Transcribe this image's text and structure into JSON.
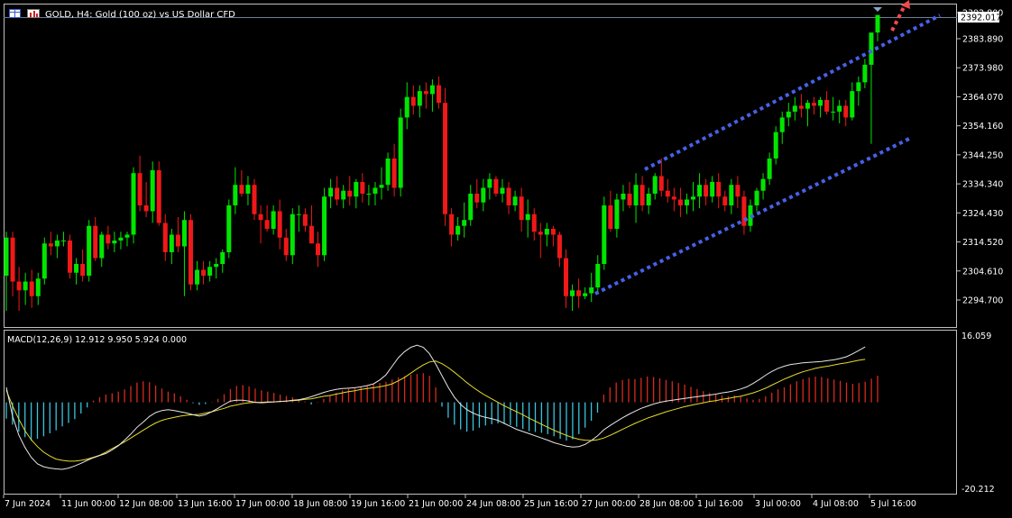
{
  "window": {
    "title": "GOLD, H4:  Gold (100 oz) vs US Dollar CFD",
    "icons": [
      "grid-icon",
      "bars-icon"
    ]
  },
  "colors": {
    "background": "#000000",
    "frame": "#c0c0c0",
    "axis_text": "#ffffff",
    "bull_candle": "#00e600",
    "bear_candle": "#f01818",
    "channel_line": "#4661e8",
    "forecast_arrow": "#f04a4a",
    "macd_positive": "#d62a1c",
    "macd_negative": "#39c3de",
    "macd_line": "#e6e6e6",
    "signal_line": "#e6dc2a",
    "price_tag_bg": "#ffffff",
    "price_tag_text": "#000000"
  },
  "price_axis": {
    "labels": [
      "2392.800",
      "2383.890",
      "2373.980",
      "2364.070",
      "2354.160",
      "2344.250",
      "2334.340",
      "2324.430",
      "2314.520",
      "2304.610",
      "2294.700"
    ],
    "current_price": "2392.017"
  },
  "macd": {
    "label": "MACD(12,26,9) 12.912 9.950 5.924 0.000",
    "axis_top": "16.059",
    "axis_bottom": "-20.212"
  },
  "time_axis": {
    "labels": [
      "7 Jun 2024",
      "11 Jun 00:00",
      "12 Jun 08:00",
      "13 Jun 16:00",
      "17 Jun 00:00",
      "18 Jun 08:00",
      "19 Jun 16:00",
      "21 Jun 00:00",
      "24 Jun 08:00",
      "25 Jun 16:00",
      "27 Jun 00:00",
      "28 Jun 08:00",
      "1 Jul 16:00",
      "3 Jul 00:00",
      "4 Jul 08:00",
      "5 Jul 16:00"
    ]
  },
  "chart_data": [
    {
      "type": "candlestick",
      "symbol": "GOLD",
      "timeframe": "H4",
      "x_labels": [
        "7 Jun 2024",
        "11 Jun 00:00",
        "12 Jun 08:00",
        "13 Jun 16:00",
        "17 Jun 00:00",
        "18 Jun 08:00",
        "19 Jun 16:00",
        "21 Jun 00:00",
        "24 Jun 08:00",
        "25 Jun 16:00",
        "27 Jun 00:00",
        "28 Jun 08:00",
        "1 Jul 16:00",
        "3 Jul 00:00",
        "4 Jul 08:00",
        "5 Jul 16:00"
      ],
      "ylim": [
        2289.2,
        2395.0
      ],
      "candles": [
        [
          2303,
          2318,
          2291,
          2316
        ],
        [
          2316,
          2318,
          2296,
          2301
        ],
        [
          2301,
          2306,
          2291,
          2298
        ],
        [
          2298,
          2304,
          2293,
          2301
        ],
        [
          2301,
          2305,
          2292,
          2296
        ],
        [
          2296,
          2304,
          2293,
          2302
        ],
        [
          2302,
          2316,
          2300,
          2314
        ],
        [
          2314,
          2318,
          2310,
          2313
        ],
        [
          2313,
          2317,
          2309,
          2315
        ],
        [
          2315,
          2318,
          2313,
          2315
        ],
        [
          2315,
          2317,
          2302,
          2304
        ],
        [
          2304,
          2309,
          2300,
          2307
        ],
        [
          2307,
          2312,
          2301,
          2303
        ],
        [
          2303,
          2322,
          2301,
          2320
        ],
        [
          2320,
          2323,
          2308,
          2309
        ],
        [
          2309,
          2318,
          2306,
          2317
        ],
        [
          2317,
          2320,
          2312,
          2314
        ],
        [
          2314,
          2318,
          2311,
          2315
        ],
        [
          2315,
          2318,
          2312,
          2316
        ],
        [
          2316,
          2318,
          2313,
          2317
        ],
        [
          2317,
          2340,
          2314,
          2338
        ],
        [
          2338,
          2344,
          2325,
          2327
        ],
        [
          2327,
          2335,
          2323,
          2325
        ],
        [
          2325,
          2342,
          2321,
          2339
        ],
        [
          2339,
          2342,
          2320,
          2321
        ],
        [
          2321,
          2324,
          2308,
          2311
        ],
        [
          2311,
          2319,
          2307,
          2317
        ],
        [
          2317,
          2323,
          2311,
          2313
        ],
        [
          2313,
          2325,
          2296,
          2322
        ],
        [
          2322,
          2324,
          2298,
          2300
        ],
        [
          2300,
          2308,
          2298,
          2305
        ],
        [
          2305,
          2308,
          2300,
          2303
        ],
        [
          2303,
          2308,
          2301,
          2306
        ],
        [
          2306,
          2309,
          2302,
          2307
        ],
        [
          2307,
          2312,
          2304,
          2311
        ],
        [
          2311,
          2329,
          2309,
          2327
        ],
        [
          2327,
          2340,
          2324,
          2334
        ],
        [
          2334,
          2339,
          2330,
          2331
        ],
        [
          2331,
          2337,
          2327,
          2334
        ],
        [
          2334,
          2336,
          2322,
          2324
        ],
        [
          2324,
          2327,
          2314,
          2322
        ],
        [
          2322,
          2327,
          2318,
          2319
        ],
        [
          2319,
          2327,
          2317,
          2325
        ],
        [
          2325,
          2329,
          2312,
          2316
        ],
        [
          2316,
          2319,
          2308,
          2310
        ],
        [
          2310,
          2326,
          2307,
          2324
        ],
        [
          2324,
          2327,
          2318,
          2324
        ],
        [
          2324,
          2326,
          2318,
          2320
        ],
        [
          2320,
          2327,
          2314,
          2314
        ],
        [
          2314,
          2318,
          2306,
          2310
        ],
        [
          2310,
          2333,
          2308,
          2330
        ],
        [
          2330,
          2336,
          2326,
          2333
        ],
        [
          2333,
          2337,
          2327,
          2329
        ],
        [
          2329,
          2334,
          2326,
          2332
        ],
        [
          2332,
          2337,
          2327,
          2330
        ],
        [
          2330,
          2336,
          2326,
          2335
        ],
        [
          2335,
          2338,
          2328,
          2331
        ],
        [
          2331,
          2334,
          2327,
          2331
        ],
        [
          2331,
          2335,
          2327,
          2333
        ],
        [
          2333,
          2340,
          2329,
          2334
        ],
        [
          2334,
          2345,
          2332,
          2343
        ],
        [
          2343,
          2348,
          2330,
          2333
        ],
        [
          2333,
          2360,
          2330,
          2357
        ],
        [
          2357,
          2369,
          2353,
          2364
        ],
        [
          2364,
          2368,
          2358,
          2361
        ],
        [
          2361,
          2368,
          2357,
          2366
        ],
        [
          2366,
          2369,
          2360,
          2365
        ],
        [
          2365,
          2370,
          2359,
          2368
        ],
        [
          2368,
          2371,
          2360,
          2362
        ],
        [
          2362,
          2367,
          2320,
          2324
        ],
        [
          2324,
          2326,
          2313,
          2317
        ],
        [
          2317,
          2323,
          2315,
          2320
        ],
        [
          2320,
          2328,
          2316,
          2322
        ],
        [
          2322,
          2334,
          2320,
          2331
        ],
        [
          2331,
          2336,
          2326,
          2328
        ],
        [
          2328,
          2336,
          2325,
          2333
        ],
        [
          2333,
          2338,
          2329,
          2336
        ],
        [
          2336,
          2337,
          2330,
          2331
        ],
        [
          2331,
          2336,
          2328,
          2333
        ],
        [
          2333,
          2335,
          2324,
          2327
        ],
        [
          2327,
          2332,
          2325,
          2330
        ],
        [
          2330,
          2333,
          2318,
          2322
        ],
        [
          2322,
          2329,
          2316,
          2324
        ],
        [
          2324,
          2326,
          2315,
          2318
        ],
        [
          2318,
          2321,
          2309,
          2317
        ],
        [
          2317,
          2321,
          2313,
          2319
        ],
        [
          2319,
          2320,
          2313,
          2317
        ],
        [
          2317,
          2318,
          2306,
          2309
        ],
        [
          2309,
          2312,
          2292,
          2296
        ],
        [
          2296,
          2300,
          2291,
          2298
        ],
        [
          2298,
          2302,
          2292,
          2296
        ],
        [
          2296,
          2299,
          2295,
          2297
        ],
        [
          2297,
          2304,
          2294,
          2299
        ],
        [
          2299,
          2310,
          2297,
          2307
        ],
        [
          2307,
          2330,
          2305,
          2327
        ],
        [
          2327,
          2332,
          2318,
          2319
        ],
        [
          2319,
          2331,
          2316,
          2329
        ],
        [
          2329,
          2334,
          2325,
          2331
        ],
        [
          2331,
          2335,
          2326,
          2327
        ],
        [
          2327,
          2338,
          2321,
          2334
        ],
        [
          2334,
          2337,
          2325,
          2327
        ],
        [
          2327,
          2333,
          2324,
          2331
        ],
        [
          2331,
          2338,
          2329,
          2337
        ],
        [
          2337,
          2343,
          2330,
          2332
        ],
        [
          2332,
          2336,
          2328,
          2330
        ],
        [
          2330,
          2333,
          2325,
          2329
        ],
        [
          2329,
          2333,
          2323,
          2327
        ],
        [
          2327,
          2331,
          2324,
          2329
        ],
        [
          2329,
          2335,
          2325,
          2330
        ],
        [
          2330,
          2338,
          2326,
          2334
        ],
        [
          2334,
          2336,
          2327,
          2330
        ],
        [
          2330,
          2337,
          2328,
          2335
        ],
        [
          2335,
          2338,
          2326,
          2330
        ],
        [
          2330,
          2332,
          2325,
          2327
        ],
        [
          2327,
          2336,
          2324,
          2334
        ],
        [
          2334,
          2337,
          2326,
          2330
        ],
        [
          2330,
          2332,
          2317,
          2320
        ],
        [
          2320,
          2329,
          2318,
          2327
        ],
        [
          2327,
          2333,
          2325,
          2332
        ],
        [
          2332,
          2338,
          2329,
          2336
        ],
        [
          2336,
          2345,
          2334,
          2343
        ],
        [
          2343,
          2354,
          2341,
          2352
        ],
        [
          2352,
          2359,
          2348,
          2357
        ],
        [
          2357,
          2362,
          2354,
          2359
        ],
        [
          2359,
          2364,
          2356,
          2361
        ],
        [
          2361,
          2365,
          2357,
          2360
        ],
        [
          2360,
          2363,
          2354,
          2362
        ],
        [
          2362,
          2364,
          2358,
          2361
        ],
        [
          2361,
          2364,
          2357,
          2363
        ],
        [
          2363,
          2366,
          2358,
          2359
        ],
        [
          2359,
          2364,
          2356,
          2359
        ],
        [
          2359,
          2363,
          2355,
          2361
        ],
        [
          2361,
          2363,
          2354,
          2357
        ],
        [
          2357,
          2369,
          2356,
          2366
        ],
        [
          2366,
          2371,
          2361,
          2369
        ],
        [
          2369,
          2377,
          2367,
          2375
        ],
        [
          2375,
          2383,
          2348,
          2386
        ],
        [
          2386,
          2392,
          2383,
          2392
        ]
      ],
      "macd_histogram": [
        -3.8,
        -5.2,
        -6.8,
        -8.1,
        -8.9,
        -8.5,
        -7.9,
        -7.2,
        -6.5,
        -5.6,
        -4.8,
        -3.9,
        -2.6,
        -1.2,
        0.4,
        1.2,
        1.8,
        2.1,
        2.5,
        3.0,
        3.8,
        4.6,
        4.9,
        4.7,
        3.9,
        3.2,
        2.5,
        2.1,
        1.4,
        0.6,
        -0.2,
        -0.6,
        -0.4,
        0.1,
        0.8,
        1.9,
        3.1,
        3.8,
        4.0,
        3.7,
        3.2,
        2.8,
        2.5,
        2.2,
        1.8,
        1.5,
        1.2,
        0.8,
        0.2,
        -0.5,
        0.1,
        0.8,
        1.5,
        2.2,
        2.8,
        3.2,
        3.5,
        3.6,
        3.9,
        4.2,
        4.5,
        4.8,
        5.3,
        5.8,
        6.1,
        6.4,
        6.6,
        6.8,
        6.2,
        3.5,
        -1.0,
        -3.6,
        -5.2,
        -6.3,
        -6.8,
        -6.6,
        -5.9,
        -5.4,
        -5.1,
        -4.9,
        -5.0,
        -5.3,
        -5.7,
        -6.2,
        -6.7,
        -6.9,
        -7.1,
        -7.4,
        -7.9,
        -8.5,
        -8.9,
        -8.6,
        -7.4,
        -5.9,
        -4.3,
        -2.4,
        1.8,
        3.5,
        4.6,
        5.2,
        5.5,
        5.4,
        5.7,
        6.0,
        5.9,
        5.6,
        5.2,
        4.9,
        4.5,
        4.1,
        3.6,
        3.1,
        2.6,
        2.2,
        1.9,
        1.6,
        1.4,
        1.6,
        1.3,
        0.9,
        0.6,
        0.8,
        1.4,
        2.2,
        3.0,
        3.5,
        4.2,
        4.9,
        5.4,
        5.8,
        6.0,
        5.9,
        5.6,
        5.3,
        5.0,
        4.6,
        4.3,
        4.5,
        4.8,
        5.5,
        6.2
      ],
      "macd_line": [
        3.5,
        -3.2,
        -7.6,
        -10.5,
        -12.8,
        -14.3,
        -15.0,
        -15.3,
        -15.5,
        -15.6,
        -15.3,
        -14.8,
        -14.2,
        -13.5,
        -12.9,
        -12.4,
        -11.9,
        -11.1,
        -10.1,
        -8.8,
        -7.4,
        -5.8,
        -4.6,
        -3.3,
        -2.4,
        -1.9,
        -1.7,
        -1.9,
        -2.2,
        -2.5,
        -2.9,
        -3.2,
        -2.9,
        -2.2,
        -1.4,
        -0.5,
        0.3,
        0.5,
        0.5,
        0.3,
        0.0,
        -0.1,
        0.0,
        0.1,
        0.2,
        0.3,
        0.5,
        0.6,
        0.9,
        1.3,
        1.8,
        2.3,
        2.7,
        3.0,
        3.2,
        3.3,
        3.4,
        3.6,
        3.9,
        4.3,
        5.2,
        6.4,
        8.4,
        10.4,
        11.8,
        12.8,
        13.3,
        12.8,
        11.3,
        8.9,
        6.2,
        3.5,
        1.2,
        -0.5,
        -1.7,
        -2.5,
        -3.1,
        -3.5,
        -3.8,
        -4.2,
        -4.9,
        -5.6,
        -6.3,
        -6.8,
        -7.3,
        -7.8,
        -8.3,
        -8.8,
        -9.4,
        -9.8,
        -10.2,
        -10.4,
        -10.3,
        -9.8,
        -8.9,
        -7.8,
        -6.4,
        -5.4,
        -4.5,
        -3.6,
        -2.8,
        -2.1,
        -1.4,
        -0.9,
        -0.4,
        0.0,
        0.3,
        0.5,
        0.7,
        0.9,
        1.1,
        1.3,
        1.5,
        1.7,
        1.9,
        2.2,
        2.4,
        2.7,
        3.1,
        3.6,
        4.4,
        5.3,
        6.3,
        7.2,
        7.9,
        8.4,
        8.8,
        9.0,
        9.2,
        9.3,
        9.4,
        9.5,
        9.7,
        9.9,
        10.2,
        10.6,
        11.3,
        12.1,
        12.9
      ],
      "signal_line": [
        2.8,
        -0.8,
        -3.9,
        -6.6,
        -8.7,
        -10.3,
        -11.6,
        -12.5,
        -13.2,
        -13.5,
        -13.7,
        -13.7,
        -13.5,
        -13.2,
        -12.8,
        -12.3,
        -11.6,
        -10.8,
        -10.0,
        -9.2,
        -8.3,
        -7.4,
        -6.5,
        -5.6,
        -4.8,
        -4.2,
        -3.8,
        -3.5,
        -3.2,
        -3.0,
        -2.9,
        -2.8,
        -2.5,
        -2.2,
        -1.8,
        -1.4,
        -0.9,
        -0.6,
        -0.3,
        -0.1,
        0.0,
        0.0,
        0.1,
        0.1,
        0.2,
        0.3,
        0.4,
        0.5,
        0.7,
        0.8,
        1.1,
        1.4,
        1.6,
        1.9,
        2.2,
        2.5,
        2.7,
        3.0,
        3.2,
        3.4,
        3.6,
        3.9,
        4.3,
        5.0,
        5.8,
        6.8,
        7.8,
        8.7,
        9.4,
        9.6,
        9.0,
        8.1,
        7.0,
        5.8,
        4.6,
        3.5,
        2.5,
        1.6,
        0.8,
        0.0,
        -0.8,
        -1.5,
        -2.2,
        -2.9,
        -3.7,
        -4.4,
        -5.1,
        -5.8,
        -6.5,
        -7.1,
        -7.7,
        -8.2,
        -8.6,
        -8.8,
        -8.9,
        -8.7,
        -8.3,
        -7.7,
        -7.0,
        -6.3,
        -5.6,
        -4.9,
        -4.3,
        -3.7,
        -3.2,
        -2.7,
        -2.2,
        -1.8,
        -1.4,
        -1.0,
        -0.7,
        -0.4,
        -0.1,
        0.2,
        0.4,
        0.7,
        0.9,
        1.2,
        1.4,
        1.8,
        2.2,
        2.7,
        3.3,
        4.0,
        4.7,
        5.4,
        6.0,
        6.6,
        7.1,
        7.5,
        7.9,
        8.2,
        8.4,
        8.7,
        9.0,
        9.2,
        9.5,
        9.8,
        10.0
      ],
      "macd_ylim": [
        -20.212,
        16.059
      ]
    }
  ]
}
